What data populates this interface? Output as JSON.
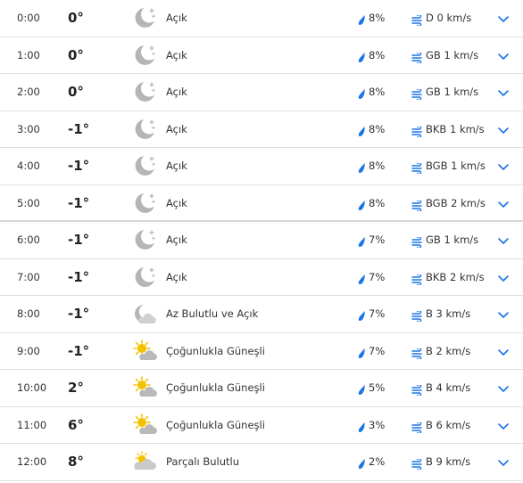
{
  "colors": {
    "accent": "#1a73e8",
    "moon": "#b5b5b5",
    "sun": "#f2c200",
    "cloud": "#b9b9b9",
    "divider": "#dedede"
  },
  "icons": {
    "moon": "crescent-moon-icon",
    "moon_cloud": "moon-cloud-icon",
    "sun_cloud": "sun-cloud-icon",
    "cloud_sun": "partly-cloudy-icon",
    "precip": "raindrop-icon",
    "wind": "wind-icon",
    "expand": "chevron-down-icon"
  },
  "hours": [
    {
      "time": "0:00",
      "temp": "0°",
      "icon": "moon",
      "condition": "Açık",
      "precip": "8%",
      "wind": "D 0 km/s"
    },
    {
      "time": "1:00",
      "temp": "0°",
      "icon": "moon",
      "condition": "Açık",
      "precip": "8%",
      "wind": "GB 1 km/s"
    },
    {
      "time": "2:00",
      "temp": "0°",
      "icon": "moon",
      "condition": "Açık",
      "precip": "8%",
      "wind": "GB 1 km/s"
    },
    {
      "time": "3:00",
      "temp": "-1°",
      "icon": "moon",
      "condition": "Açık",
      "precip": "8%",
      "wind": "BKB 1 km/s"
    },
    {
      "time": "4:00",
      "temp": "-1°",
      "icon": "moon",
      "condition": "Açık",
      "precip": "8%",
      "wind": "BGB 1 km/s"
    },
    {
      "time": "5:00",
      "temp": "-1°",
      "icon": "moon",
      "condition": "Açık",
      "precip": "8%",
      "wind": "BGB 2 km/s"
    },
    {
      "time": "6:00",
      "temp": "-1°",
      "icon": "moon",
      "condition": "Açık",
      "precip": "7%",
      "wind": "GB 1 km/s"
    },
    {
      "time": "7:00",
      "temp": "-1°",
      "icon": "moon",
      "condition": "Açık",
      "precip": "7%",
      "wind": "BKB 2 km/s"
    },
    {
      "time": "8:00",
      "temp": "-1°",
      "icon": "moon_cloud",
      "condition": "Az Bulutlu ve Açık",
      "precip": "7%",
      "wind": "B 3 km/s"
    },
    {
      "time": "9:00",
      "temp": "-1°",
      "icon": "sun_cloud",
      "condition": "Çoğunlukla Güneşli",
      "precip": "7%",
      "wind": "B 2 km/s"
    },
    {
      "time": "10:00",
      "temp": "2°",
      "icon": "sun_cloud",
      "condition": "Çoğunlukla Güneşli",
      "precip": "5%",
      "wind": "B 4 km/s"
    },
    {
      "time": "11:00",
      "temp": "6°",
      "icon": "sun_cloud",
      "condition": "Çoğunlukla Güneşli",
      "precip": "3%",
      "wind": "B 6 km/s"
    },
    {
      "time": "12:00",
      "temp": "8°",
      "icon": "cloud_sun",
      "condition": "Parçalı Bulutlu",
      "precip": "2%",
      "wind": "B 9 km/s"
    }
  ]
}
